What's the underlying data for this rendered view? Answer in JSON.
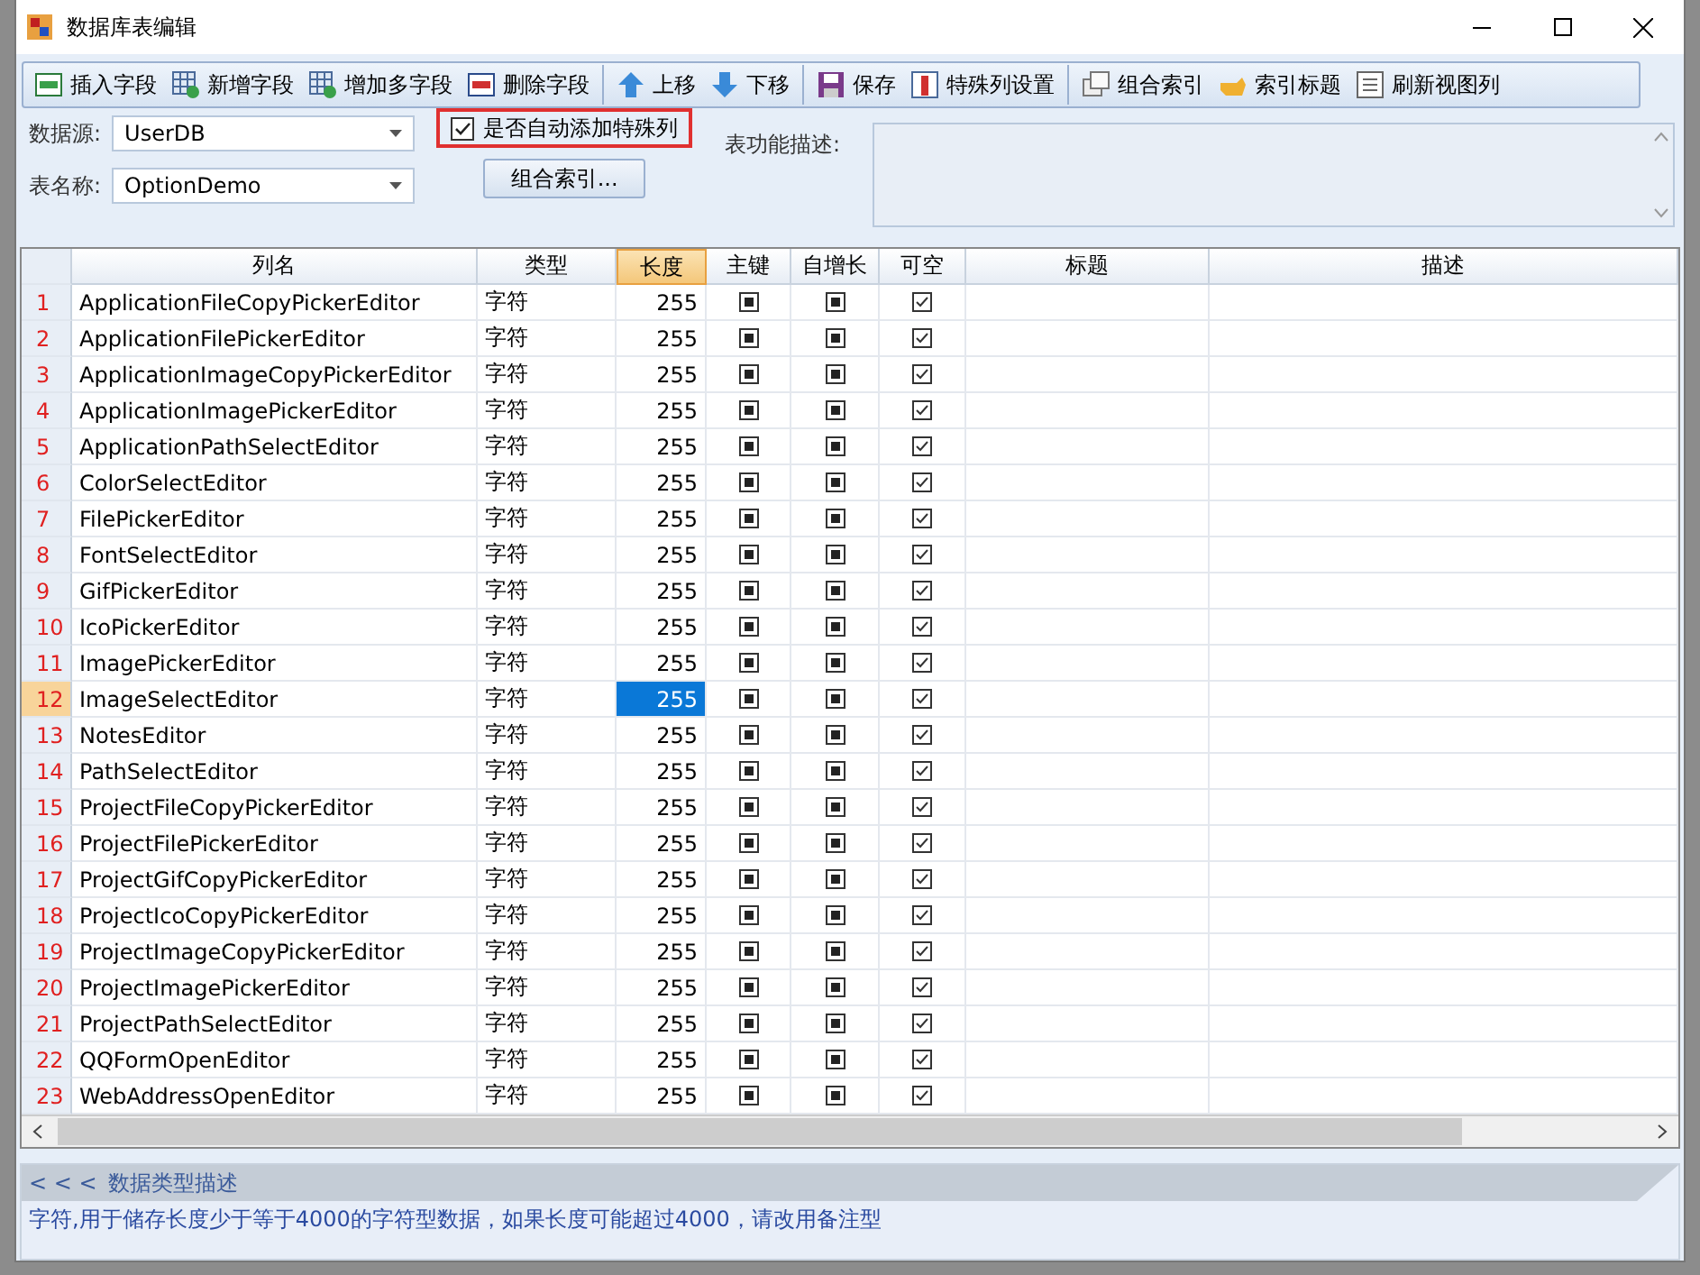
{
  "window": {
    "title": "数据库表编辑"
  },
  "toolbar": [
    {
      "label": "插入字段",
      "sep_before": false
    },
    {
      "label": "新增字段",
      "sep_before": false
    },
    {
      "label": "增加多字段",
      "sep_before": false
    },
    {
      "label": "删除字段",
      "sep_before": false
    },
    {
      "label": "上移",
      "sep_before": true
    },
    {
      "label": "下移",
      "sep_before": false
    },
    {
      "label": "保存",
      "sep_before": true
    },
    {
      "label": "特殊列设置",
      "sep_before": false
    },
    {
      "label": "组合索引",
      "sep_before": true
    },
    {
      "label": "索引标题",
      "sep_before": false
    },
    {
      "label": "刷新视图列",
      "sep_before": false
    }
  ],
  "form": {
    "datasource_label": "数据源:",
    "datasource": "UserDB",
    "table_label": "表名称:",
    "table": "OptionDemo",
    "auto_special": {
      "label": "是否自动添加特殊列",
      "checked": true
    },
    "index_button": "组合索引...",
    "desc_label": "表功能描述:"
  },
  "table": {
    "columns": [
      {
        "label": "列名",
        "selected": false
      },
      {
        "label": "类型",
        "selected": false
      },
      {
        "label": "长度",
        "selected": true
      },
      {
        "label": "主键",
        "selected": false
      },
      {
        "label": "自增长",
        "selected": false
      },
      {
        "label": "可空",
        "selected": false
      },
      {
        "label": "标题",
        "selected": false
      },
      {
        "label": "描述",
        "selected": false
      }
    ],
    "rows": [
      {
        "num": "1",
        "name": "ApplicationFileCopyPickerEditor",
        "type": "字符",
        "length": "255",
        "primary_key_indeterminate": true,
        "auto_increment_indeterminate": true,
        "nullable": true,
        "selected": false
      },
      {
        "num": "2",
        "name": "ApplicationFilePickerEditor",
        "type": "字符",
        "length": "255",
        "primary_key_indeterminate": true,
        "auto_increment_indeterminate": true,
        "nullable": true,
        "selected": false
      },
      {
        "num": "3",
        "name": "ApplicationImageCopyPickerEditor",
        "type": "字符",
        "length": "255",
        "primary_key_indeterminate": true,
        "auto_increment_indeterminate": true,
        "nullable": true,
        "selected": false
      },
      {
        "num": "4",
        "name": "ApplicationImagePickerEditor",
        "type": "字符",
        "length": "255",
        "primary_key_indeterminate": true,
        "auto_increment_indeterminate": true,
        "nullable": true,
        "selected": false
      },
      {
        "num": "5",
        "name": "ApplicationPathSelectEditor",
        "type": "字符",
        "length": "255",
        "primary_key_indeterminate": true,
        "auto_increment_indeterminate": true,
        "nullable": true,
        "selected": false
      },
      {
        "num": "6",
        "name": "ColorSelectEditor",
        "type": "字符",
        "length": "255",
        "primary_key_indeterminate": true,
        "auto_increment_indeterminate": true,
        "nullable": true,
        "selected": false
      },
      {
        "num": "7",
        "name": "FilePickerEditor",
        "type": "字符",
        "length": "255",
        "primary_key_indeterminate": true,
        "auto_increment_indeterminate": true,
        "nullable": true,
        "selected": false
      },
      {
        "num": "8",
        "name": "FontSelectEditor",
        "type": "字符",
        "length": "255",
        "primary_key_indeterminate": true,
        "auto_increment_indeterminate": true,
        "nullable": true,
        "selected": false
      },
      {
        "num": "9",
        "name": "GifPickerEditor",
        "type": "字符",
        "length": "255",
        "primary_key_indeterminate": true,
        "auto_increment_indeterminate": true,
        "nullable": true,
        "selected": false
      },
      {
        "num": "10",
        "name": "IcoPickerEditor",
        "type": "字符",
        "length": "255",
        "primary_key_indeterminate": true,
        "auto_increment_indeterminate": true,
        "nullable": true,
        "selected": false
      },
      {
        "num": "11",
        "name": "ImagePickerEditor",
        "type": "字符",
        "length": "255",
        "primary_key_indeterminate": true,
        "auto_increment_indeterminate": true,
        "nullable": true,
        "selected": false
      },
      {
        "num": "12",
        "name": "ImageSelectEditor",
        "type": "字符",
        "length": "255",
        "primary_key_indeterminate": true,
        "auto_increment_indeterminate": true,
        "nullable": true,
        "selected": true
      },
      {
        "num": "13",
        "name": "NotesEditor",
        "type": "字符",
        "length": "255",
        "primary_key_indeterminate": true,
        "auto_increment_indeterminate": true,
        "nullable": true,
        "selected": false
      },
      {
        "num": "14",
        "name": "PathSelectEditor",
        "type": "字符",
        "length": "255",
        "primary_key_indeterminate": true,
        "auto_increment_indeterminate": true,
        "nullable": true,
        "selected": false
      },
      {
        "num": "15",
        "name": "ProjectFileCopyPickerEditor",
        "type": "字符",
        "length": "255",
        "primary_key_indeterminate": true,
        "auto_increment_indeterminate": true,
        "nullable": true,
        "selected": false
      },
      {
        "num": "16",
        "name": "ProjectFilePickerEditor",
        "type": "字符",
        "length": "255",
        "primary_key_indeterminate": true,
        "auto_increment_indeterminate": true,
        "nullable": true,
        "selected": false
      },
      {
        "num": "17",
        "name": "ProjectGifCopyPickerEditor",
        "type": "字符",
        "length": "255",
        "primary_key_indeterminate": true,
        "auto_increment_indeterminate": true,
        "nullable": true,
        "selected": false
      },
      {
        "num": "18",
        "name": "ProjectIcoCopyPickerEditor",
        "type": "字符",
        "length": "255",
        "primary_key_indeterminate": true,
        "auto_increment_indeterminate": true,
        "nullable": true,
        "selected": false
      },
      {
        "num": "19",
        "name": "ProjectImageCopyPickerEditor",
        "type": "字符",
        "length": "255",
        "primary_key_indeterminate": true,
        "auto_increment_indeterminate": true,
        "nullable": true,
        "selected": false
      },
      {
        "num": "20",
        "name": "ProjectImagePickerEditor",
        "type": "字符",
        "length": "255",
        "primary_key_indeterminate": true,
        "auto_increment_indeterminate": true,
        "nullable": true,
        "selected": false
      },
      {
        "num": "21",
        "name": "ProjectPathSelectEditor",
        "type": "字符",
        "length": "255",
        "primary_key_indeterminate": true,
        "auto_increment_indeterminate": true,
        "nullable": true,
        "selected": false
      },
      {
        "num": "22",
        "name": "QQFormOpenEditor",
        "type": "字符",
        "length": "255",
        "primary_key_indeterminate": true,
        "auto_increment_indeterminate": true,
        "nullable": true,
        "selected": false
      },
      {
        "num": "23",
        "name": "WebAddressOpenEditor",
        "type": "字符",
        "length": "255",
        "primary_key_indeterminate": true,
        "auto_increment_indeterminate": true,
        "nullable": true,
        "selected": false
      }
    ]
  },
  "description_panel": {
    "toggle": "< < <",
    "title": "数据类型描述",
    "text": "字符,用于储存长度少于等于4000的字符型数据，如果长度可能超过4000，请改用备注型"
  }
}
